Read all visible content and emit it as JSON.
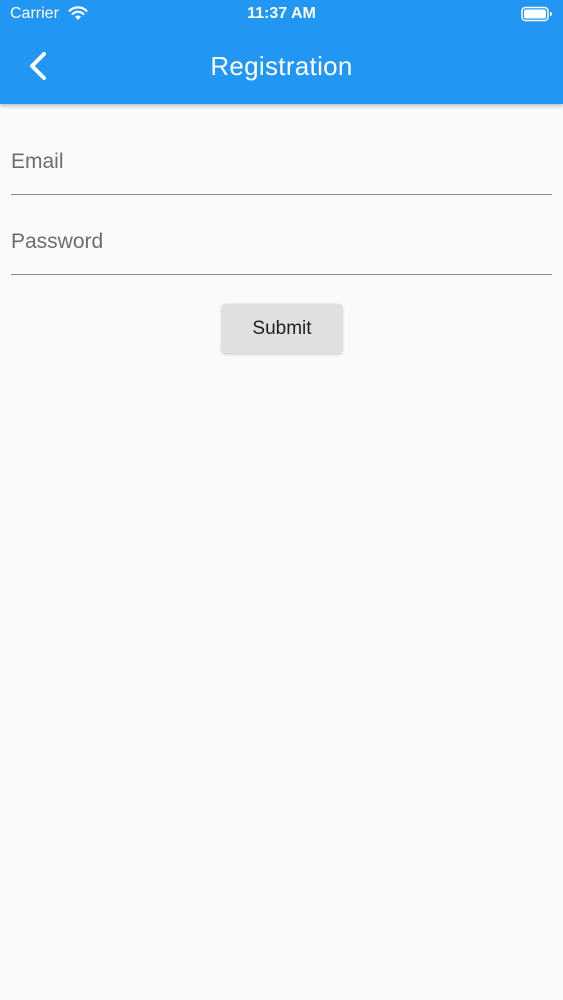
{
  "status_bar": {
    "carrier": "Carrier",
    "time": "11:37 AM",
    "wifi_icon": "wifi-icon",
    "battery_icon": "battery-icon"
  },
  "app_bar": {
    "title": "Registration",
    "back_icon": "chevron-left-icon",
    "color": "#2196f3"
  },
  "form": {
    "email": {
      "label": "Email",
      "value": ""
    },
    "password": {
      "label": "Password",
      "value": ""
    },
    "submit_label": "Submit"
  }
}
